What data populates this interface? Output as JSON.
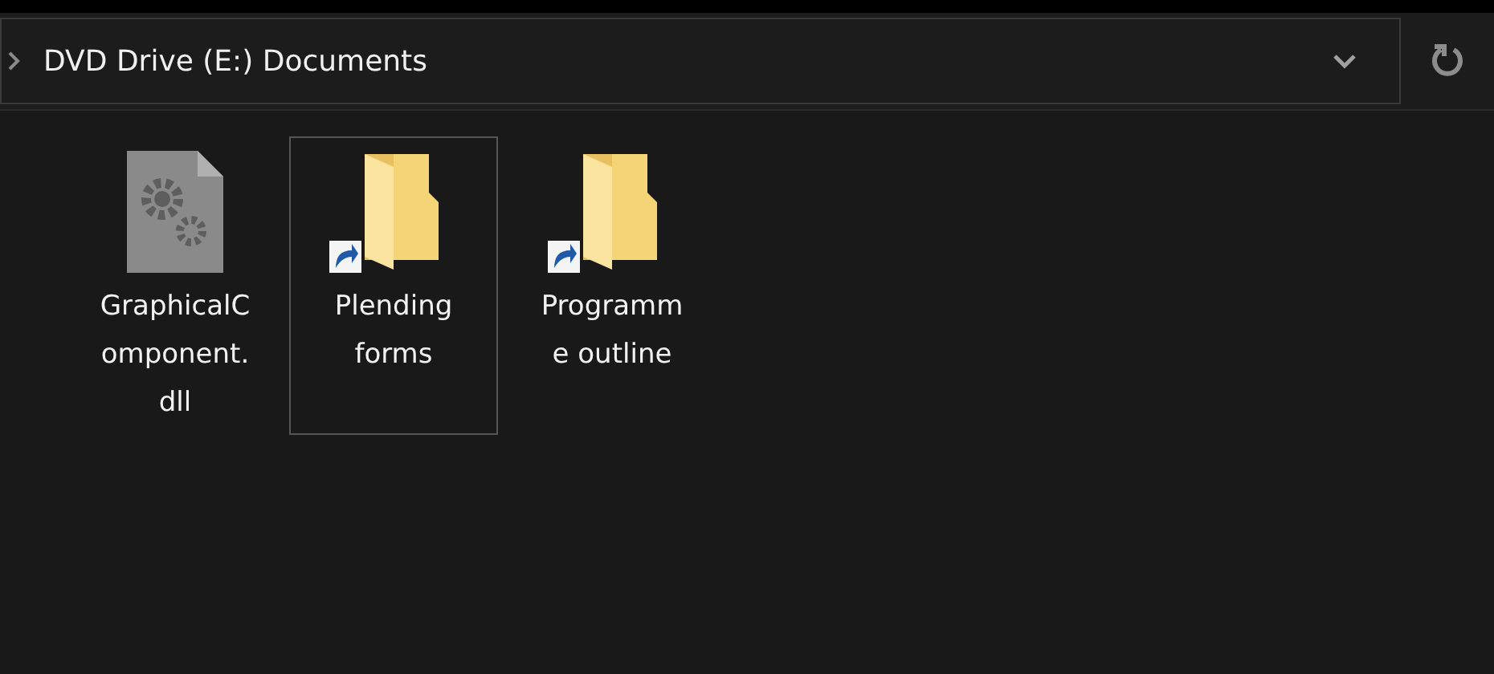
{
  "address_bar": {
    "path": "DVD Drive (E:) Documents"
  },
  "items": [
    {
      "kind": "dll",
      "name_lines": [
        "GraphicalC",
        "omponent.",
        "dll"
      ],
      "shortcut": false,
      "selected": false
    },
    {
      "kind": "folder",
      "name_lines": [
        "Plending",
        "forms"
      ],
      "shortcut": true,
      "selected": true
    },
    {
      "kind": "folder",
      "name_lines": [
        "Programm",
        "e outline"
      ],
      "shortcut": true,
      "selected": false
    }
  ]
}
